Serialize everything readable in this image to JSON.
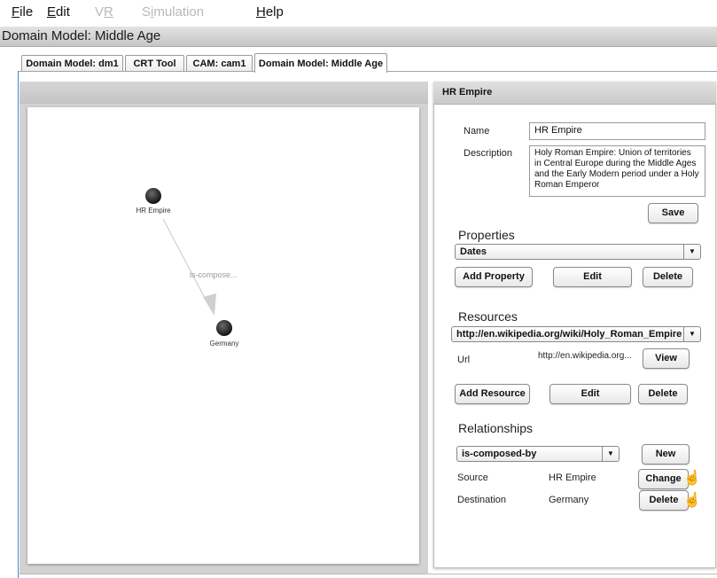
{
  "menu": [
    {
      "mnemonic": "F",
      "rest": "ile",
      "disabled": false
    },
    {
      "mnemonic": "E",
      "rest": "dit",
      "disabled": false
    },
    {
      "pre": "V",
      "mnemonic": "R",
      "rest": "",
      "disabled": true
    },
    {
      "pre": "S",
      "mnemonic": "i",
      "rest": "mulation",
      "disabled": true
    },
    {
      "mnemonic": "H",
      "rest": "elp",
      "disabled": false
    }
  ],
  "window_title": "Domain Model: Middle Age",
  "tabs": [
    "Domain Model: dm1",
    "CRT Tool",
    "CAM: cam1",
    "Domain Model: Middle Age"
  ],
  "graph": {
    "nodes": [
      {
        "label": "HR Empire"
      },
      {
        "label": "Germany"
      }
    ],
    "edge_label": "is-compose..."
  },
  "details": {
    "header": "HR Empire",
    "name_label": "Name",
    "name_value": "HR Empire",
    "description_label": "Description",
    "description_value": "Holy Roman Empire: Union of territories in Central Europe during the Middle Ages and the Early Modern period under a Holy Roman Emperor",
    "save_button": "Save",
    "properties_title": "Properties",
    "properties_selected": "Dates",
    "add_property_button": "Add Property",
    "edit_property_button": "Edit",
    "delete_property_button": "Delete",
    "resources_title": "Resources",
    "resources_selected": "http://en.wikipedia.org/wiki/Holy_Roman_Empire",
    "url_label": "Url",
    "url_value": "http://en.wikipedia.org...",
    "view_button": "View",
    "add_resource_button": "Add Resource",
    "edit_resource_button": "Edit",
    "delete_resource_button": "Delete",
    "relationships_title": "Relationships",
    "relationship_selected": "is-composed-by",
    "new_button": "New",
    "source_label": "Source",
    "source_value": "HR Empire",
    "change_button": "Change",
    "destination_label": "Destination",
    "destination_value": "Germany",
    "delete_relationship_button": "Delete"
  }
}
